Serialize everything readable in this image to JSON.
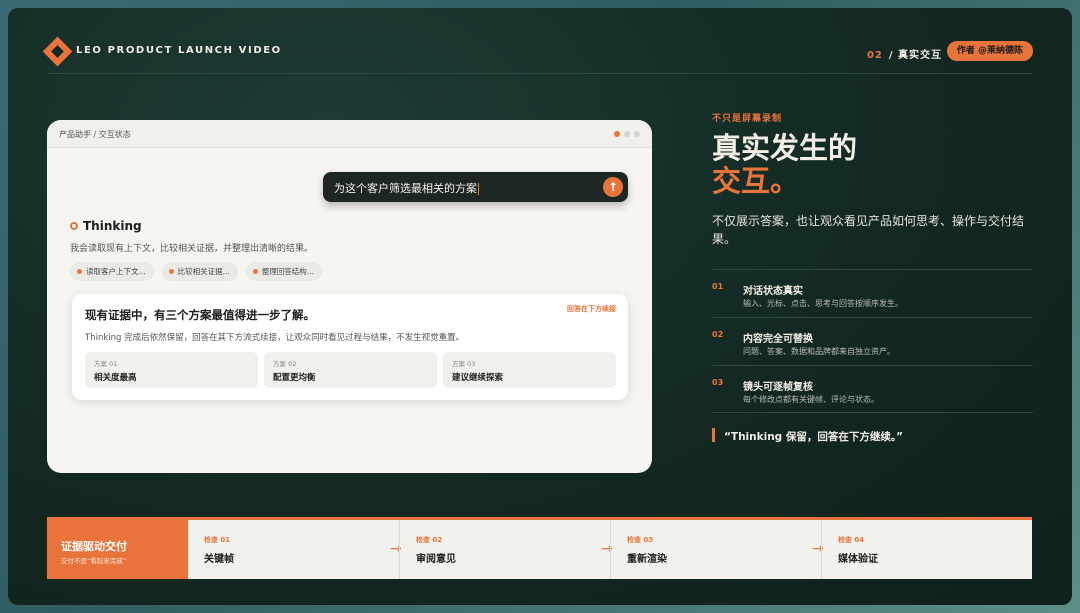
{
  "header": {
    "brand": "LEO PRODUCT LAUNCH VIDEO",
    "section_num": "02",
    "section_sep": "/",
    "section_title": "真实交互",
    "author": "作者 @莱纳德陈"
  },
  "window": {
    "breadcrumb": "产品助手 / 交互状态",
    "prompt": "为这个客户筛选最相关的方案",
    "send_icon": "↑",
    "thinking_title": "Thinking",
    "thinking_desc": "我会读取现有上下文，比较相关证据，并整理出清晰的结果。",
    "chips": [
      "读取客户上下文...",
      "比较相关证据...",
      "整理回答结构..."
    ],
    "answer": {
      "title": "现有证据中，有三个方案最值得进一步了解。",
      "tag": "回答在下方续接",
      "desc": "Thinking 完成后依然保留，回答在其下方流式续接，让观众同时看见过程与结果，不发生视觉重置。",
      "options": [
        {
          "key": "方案 01",
          "value": "相关度最高"
        },
        {
          "key": "方案 02",
          "value": "配置更均衡"
        },
        {
          "key": "方案 03",
          "value": "建议继续探索"
        }
      ]
    }
  },
  "side": {
    "eyebrow": "不只是屏幕录制",
    "headline_1": "真实发生的",
    "headline_2": "交互。",
    "lead": "不仅展示答案，也让观众看见产品如何思考、操作与交付结果。",
    "features": [
      {
        "num": "01",
        "title": "对话状态真实",
        "desc": "输入、光标、点击、思考与回答按顺序发生。"
      },
      {
        "num": "02",
        "title": "内容完全可替换",
        "desc": "问题、答案、数据和品牌都来自独立资产。"
      },
      {
        "num": "03",
        "title": "镜头可逐帧复核",
        "desc": "每个修改点都有关键帧、评论与状态。"
      }
    ],
    "quote": "“Thinking 保留，回答在下方继续。”"
  },
  "strip": {
    "lead_title": "证据驱动交付",
    "lead_sub": "交付不是“看起来完成”",
    "arrow_icon": "→",
    "steps": [
      {
        "key": "检查 01",
        "value": "关键帧"
      },
      {
        "key": "检查 02",
        "value": "审阅意见"
      },
      {
        "key": "检查 03",
        "value": "重新渲染"
      },
      {
        "key": "检查 04",
        "value": "媒体验证"
      }
    ]
  },
  "colors": {
    "accent": "#e8743b",
    "bg": "#132822",
    "card": "#f6f5f2"
  }
}
